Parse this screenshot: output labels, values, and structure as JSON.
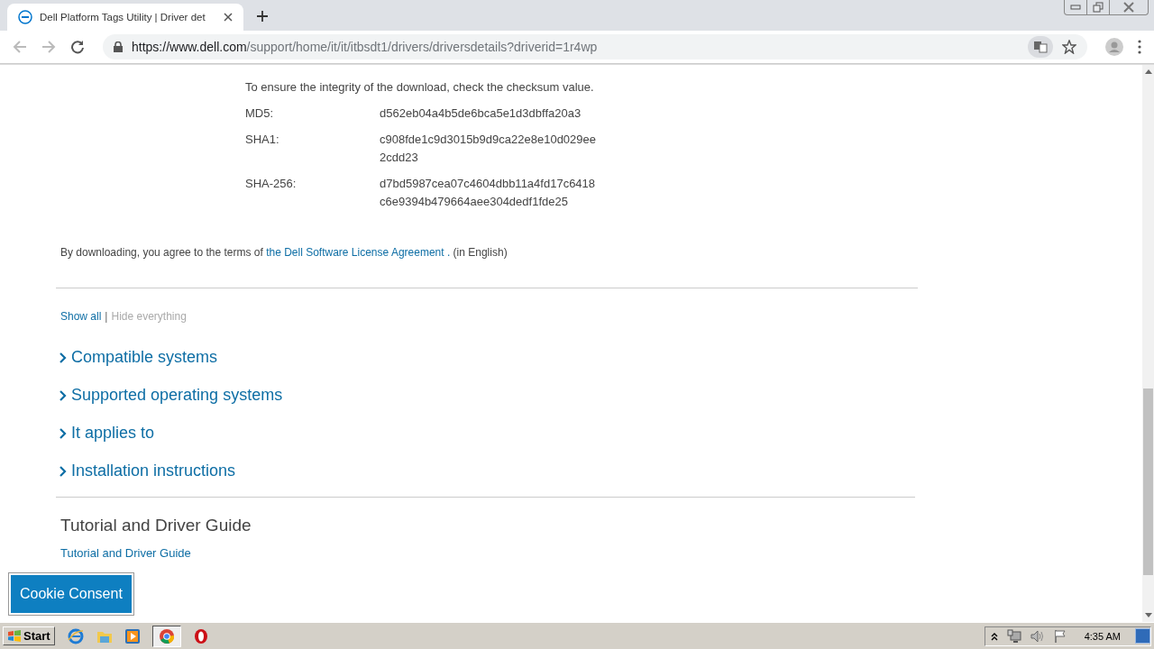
{
  "browser": {
    "tab": {
      "title": "Dell Platform Tags Utility | Driver det",
      "selected": true
    },
    "url": {
      "host": "https://www.dell.com",
      "path": "/support/home/it/it/itbsdt1/drivers/driversdetails?driverid=1r4wp"
    }
  },
  "checksum": {
    "intro": "To ensure the integrity of the download, check the checksum value.",
    "rows": [
      {
        "label": "MD5:",
        "value": [
          "d562eb04a4b5de6bca5e1d3dbffa20a3"
        ]
      },
      {
        "label": "SHA1:",
        "value": [
          "c908fde1c9d3015b9d9ca22e8e10d029ee",
          "2cdd23"
        ]
      },
      {
        "label": "SHA-256:",
        "value": [
          "d7bd5987cea07c4604dbb11a4fd17c6418",
          "c6e9394b479664aee304dedf1fde25"
        ]
      }
    ]
  },
  "license": {
    "before": "By downloading, you agree to the terms of",
    "link": "the Dell Software License Agreement .",
    "after": "(in English)"
  },
  "toggle_separator": "|",
  "toggles": [
    {
      "label": "Show all",
      "disabled": false
    },
    {
      "label": "Hide everything",
      "disabled": true
    }
  ],
  "sections": [
    {
      "label": "Compatible systems",
      "expanded": false
    },
    {
      "label": "Supported operating systems",
      "expanded": false
    },
    {
      "label": "It applies to",
      "expanded": false
    },
    {
      "label": "Installation instructions",
      "expanded": false
    }
  ],
  "guide": {
    "heading": "Tutorial and Driver Guide",
    "link": "Tutorial and Driver Guide"
  },
  "cookie_button": "Cookie Consent",
  "taskbar": {
    "start": "Start",
    "time": "4:35 AM"
  }
}
